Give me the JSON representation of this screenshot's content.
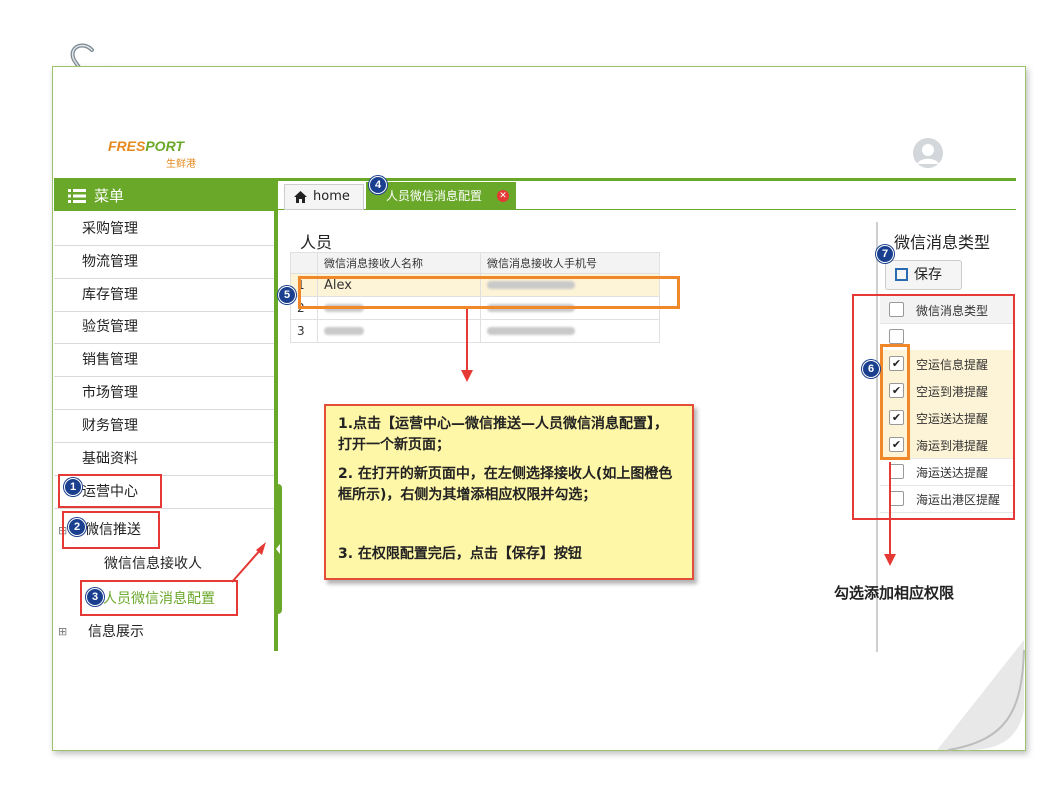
{
  "logo": {
    "text_a": "FRES",
    "text_b": "PORT",
    "sub": "生鲜港"
  },
  "menu": {
    "title": "菜单",
    "items": [
      "采购管理",
      "物流管理",
      "库存管理",
      "验货管理",
      "销售管理",
      "市场管理",
      "财务管理",
      "基础资料",
      "运营中心"
    ],
    "sub_wechat": "微信推送",
    "sub_receiver": "微信信息接收人",
    "sub_config": "人员微信消息配置",
    "sub_info": "信息展示"
  },
  "tabs": {
    "home": "home",
    "active": "人员微信消息配置"
  },
  "people": {
    "title": "人员",
    "col_name": "微信消息接收人名称",
    "col_phone": "微信消息接收人手机号",
    "rows": [
      {
        "no": "1",
        "name": "Alex"
      },
      {
        "no": "2",
        "name": ""
      },
      {
        "no": "3",
        "name": ""
      }
    ]
  },
  "types": {
    "title": "微信消息类型",
    "save": "保存",
    "col": "微信消息类型",
    "rows": [
      {
        "label": "",
        "checked": false
      },
      {
        "label": "空运信息提醒",
        "checked": true
      },
      {
        "label": "空运到港提醒",
        "checked": true
      },
      {
        "label": "空运送达提醒",
        "checked": true
      },
      {
        "label": "海运到港提醒",
        "checked": true
      },
      {
        "label": "海运送达提醒",
        "checked": false
      },
      {
        "label": "海运出港区提醒",
        "checked": false
      }
    ]
  },
  "note": {
    "p1": "1.点击【运营中心—微信推送—人员微信消息配置】，打开一个新页面；",
    "p2": "2. 在打开的新页面中，在左侧选择接收人(如上图橙色框所示)，右侧为其增添相应权限并勾选；",
    "p3": "3. 在权限配置完后，点击【保存】按钮"
  },
  "caption": "勾选添加相应权限",
  "badges": [
    "1",
    "2",
    "3",
    "4",
    "5",
    "6",
    "7"
  ],
  "check_mark": "✔",
  "colors": {
    "green": "#6aa82a",
    "red": "#e53935",
    "orange": "#f0882a",
    "note_bg": "#fff7a8"
  }
}
